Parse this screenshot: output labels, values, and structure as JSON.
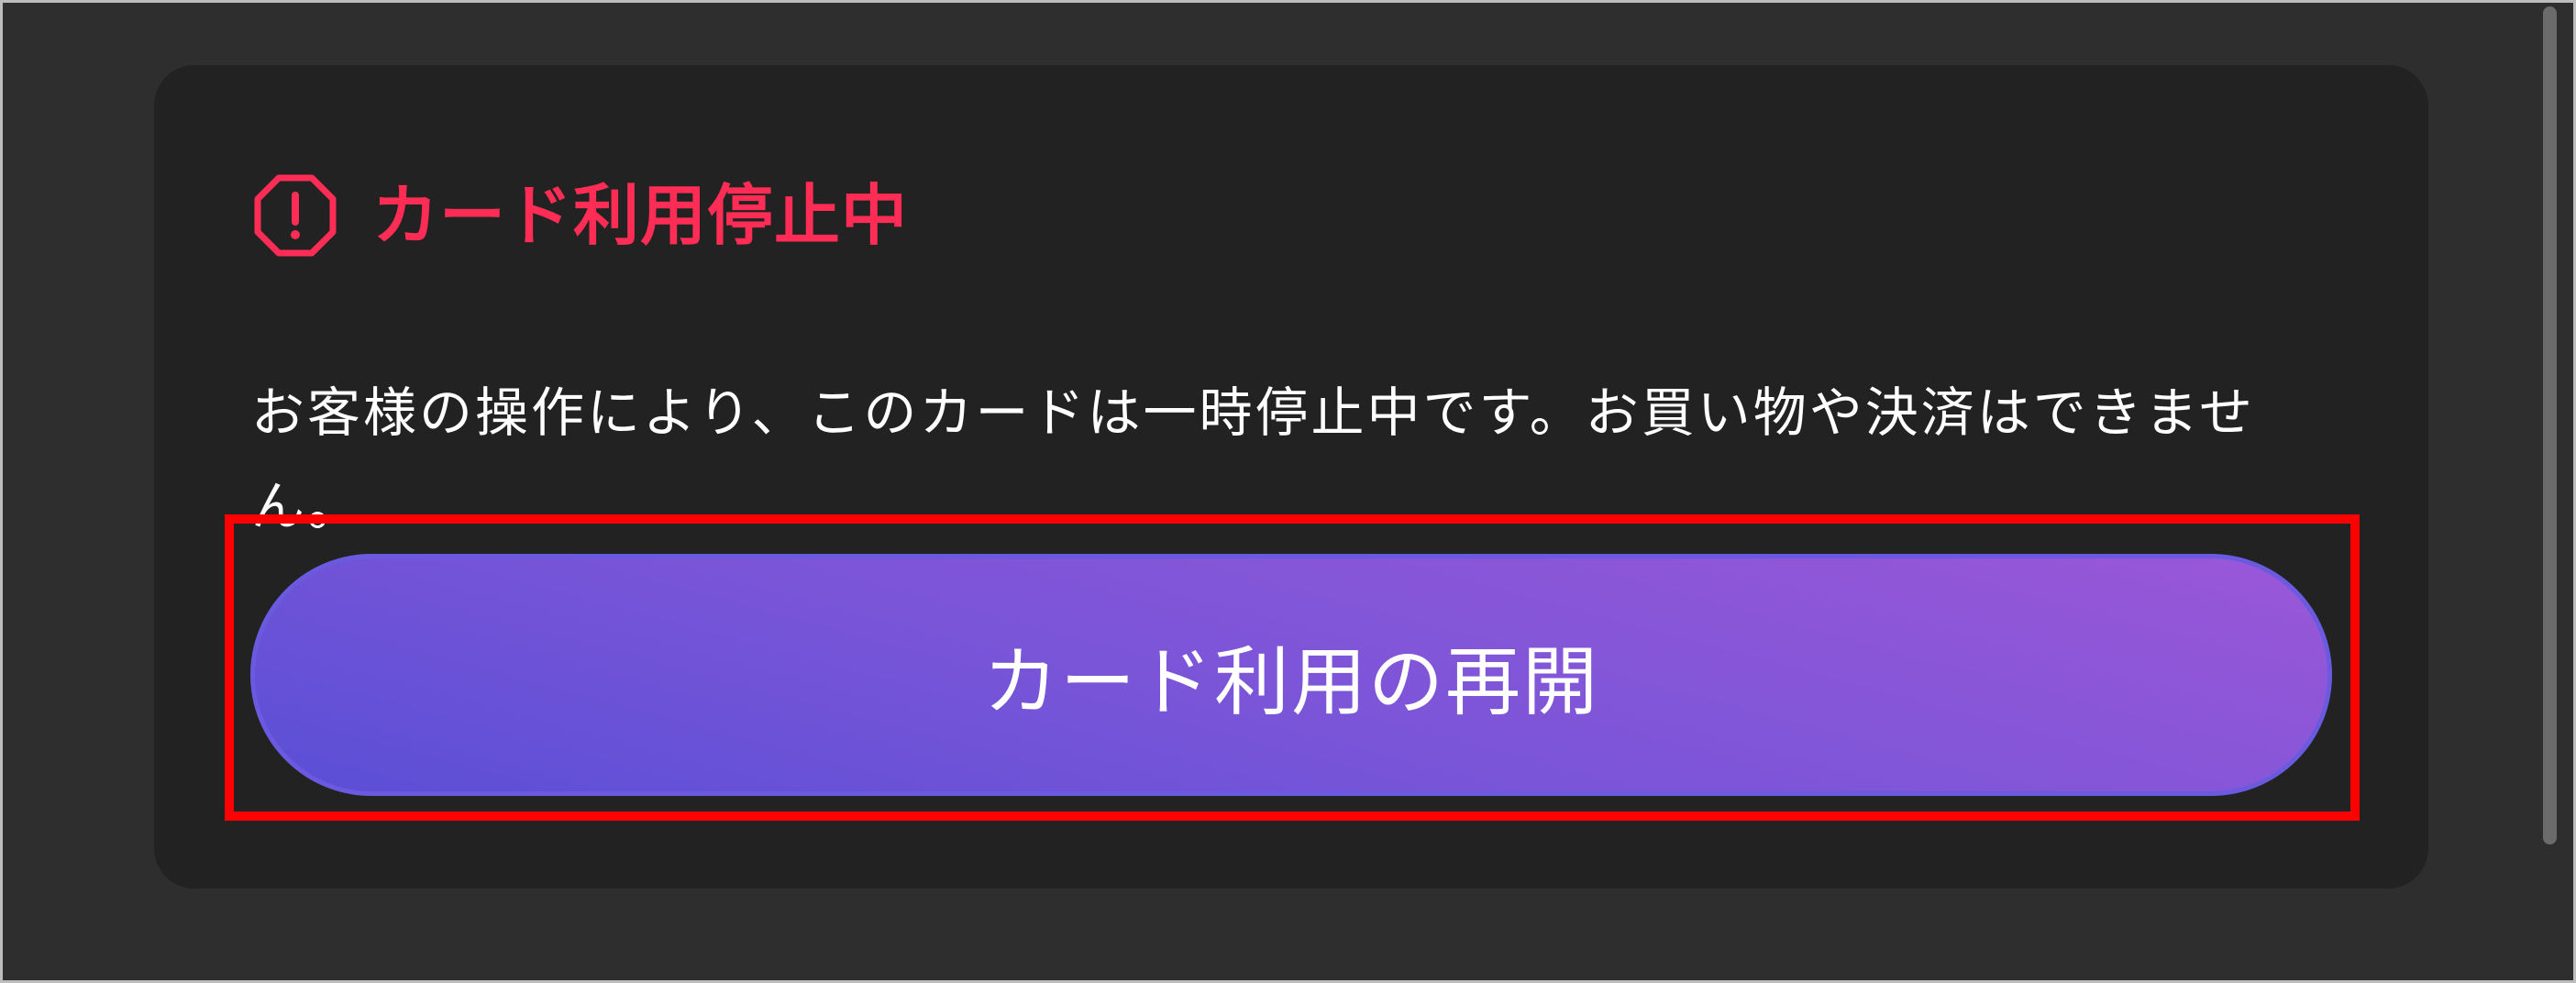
{
  "card": {
    "status_title": "カード利用停止中",
    "status_icon": "alert-octagon-icon",
    "status_color": "#ff2d55",
    "message": "お客様の操作により、このカードは一時停止中です。お買い物や決済はできません。",
    "resume_button_label": "カード利用の再開",
    "highlight_color": "#ff0000"
  }
}
